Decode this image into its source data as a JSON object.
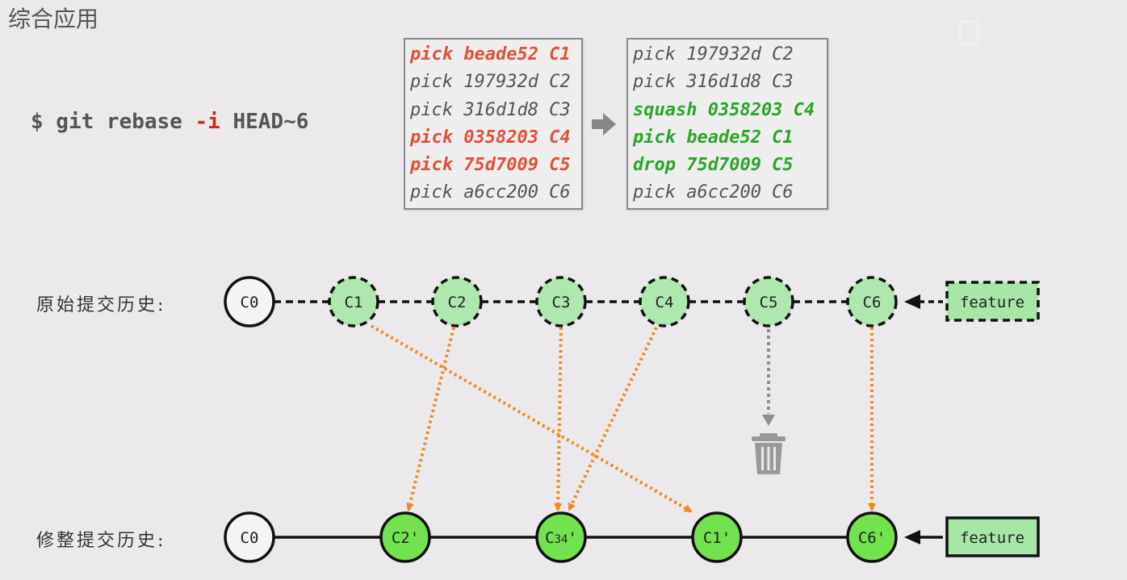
{
  "title": "综合应用",
  "command": {
    "prefix": "$ git rebase ",
    "flag": "-i",
    "suffix": " HEAD~6"
  },
  "todo_before": [
    {
      "text": "pick beade52 C1",
      "style": "red"
    },
    {
      "text": "pick 197932d C2",
      "style": "normal"
    },
    {
      "text": "pick 316d1d8 C3",
      "style": "normal"
    },
    {
      "text": "pick 0358203 C4",
      "style": "red"
    },
    {
      "text": "pick 75d7009 C5",
      "style": "red"
    },
    {
      "text": "pick a6cc200 C6",
      "style": "normal"
    }
  ],
  "todo_after": [
    {
      "text": "pick 197932d C2",
      "style": "normal"
    },
    {
      "text": "pick 316d1d8 C3",
      "style": "normal"
    },
    {
      "text": "squash 0358203 C4",
      "style": "green"
    },
    {
      "text": "pick beade52 C1",
      "style": "green"
    },
    {
      "text": "drop 75d7009 C5",
      "style": "green"
    },
    {
      "text": "pick a6cc200 C6",
      "style": "normal"
    }
  ],
  "labels": {
    "original": "原始提交历史:",
    "rewritten": "修整提交历史:"
  },
  "original_commits": [
    "C0",
    "C1",
    "C2",
    "C3",
    "C4",
    "C5",
    "C6"
  ],
  "rewritten_commits": [
    {
      "label": "C0",
      "sub": ""
    },
    {
      "label": "C2'",
      "sub": ""
    },
    {
      "label": "C",
      "sub": "34",
      "suffix": "'"
    },
    {
      "label": "C1'",
      "sub": ""
    },
    {
      "label": "C6'",
      "sub": ""
    }
  ],
  "mappings": [
    {
      "from": "C1",
      "to": "C1'"
    },
    {
      "from": "C2",
      "to": "C2'"
    },
    {
      "from": "C3",
      "to": "C34'"
    },
    {
      "from": "C4",
      "to": "C34'"
    },
    {
      "from": "C5",
      "to": "trash"
    },
    {
      "from": "C6",
      "to": "C6'"
    }
  ],
  "branch": {
    "original": "feature",
    "rewritten": "feature"
  },
  "colors": {
    "background": "#ebe9ec",
    "node_original_fill": "#aee8ae",
    "node_new_fill": "#72e24e",
    "branch_fill": "#a7e6a7",
    "mapping_arrow": "#ee8a1e",
    "drop_arrow": "#8e8e8e",
    "highlight_red": "#e0503a",
    "highlight_green": "#2aa628"
  }
}
